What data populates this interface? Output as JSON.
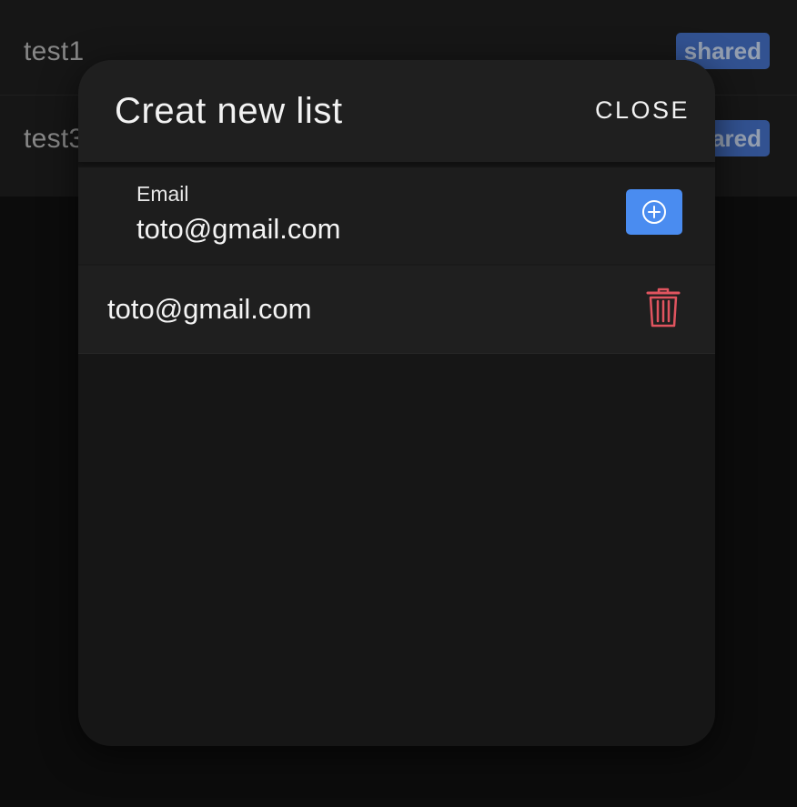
{
  "background_list": {
    "items": [
      {
        "name": "test1",
        "badge": "shared"
      },
      {
        "name": "test3",
        "badge": "shared"
      }
    ]
  },
  "modal": {
    "title": "Creat new list",
    "close_label": "CLOSE",
    "email_field": {
      "label": "Email",
      "value": "toto@gmail.com",
      "add_icon": "plus-circle-icon"
    },
    "shared_emails": [
      {
        "email": "toto@gmail.com",
        "delete_icon": "trash-icon"
      }
    ]
  },
  "colors": {
    "accent": "#4a8cf0",
    "badge": "#3a5ea6",
    "danger": "#e0545f",
    "modal_bg": "#161616"
  }
}
